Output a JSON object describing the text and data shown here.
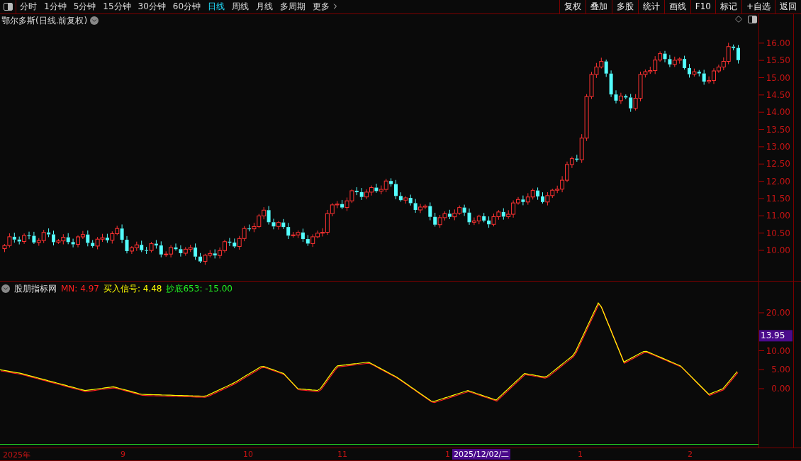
{
  "toolbar": {
    "periods": [
      {
        "label": "分时",
        "selected": false
      },
      {
        "label": "1分钟",
        "selected": false
      },
      {
        "label": "5分钟",
        "selected": false
      },
      {
        "label": "15分钟",
        "selected": false
      },
      {
        "label": "30分钟",
        "selected": false
      },
      {
        "label": "60分钟",
        "selected": false
      },
      {
        "label": "日线",
        "selected": true
      },
      {
        "label": "周线",
        "selected": false
      },
      {
        "label": "月线",
        "selected": false
      },
      {
        "label": "多周期",
        "selected": false
      }
    ],
    "more": "更多",
    "actions": [
      "复权",
      "叠加",
      "多股",
      "统计",
      "画线",
      "F10",
      "标记",
      "+自选",
      "返回"
    ]
  },
  "main_chart": {
    "title": "鄂尔多斯(日线.前复权)",
    "price_ticks": [
      "16.00",
      "15.50",
      "15.00",
      "14.50",
      "14.00",
      "13.50",
      "13.00",
      "12.50",
      "12.00",
      "11.50",
      "11.00",
      "10.50",
      "10.00"
    ]
  },
  "indicator": {
    "name": "股朋指标网",
    "values": [
      {
        "label": "MN: 4.97",
        "color": "#ff2020"
      },
      {
        "label": "买入信号: 4.48",
        "color": "#ffff00"
      },
      {
        "label": "抄底653: -15.00",
        "color": "#22ee22"
      }
    ],
    "ticks": [
      "20.00",
      "10.00",
      "5.00",
      "0.00"
    ],
    "cursor_value": "13.95"
  },
  "time_axis": {
    "labels": [
      "2025年",
      "9",
      "10",
      "11",
      "1",
      "1",
      "2"
    ],
    "cursor_date": "2025/12/02/二"
  }
}
